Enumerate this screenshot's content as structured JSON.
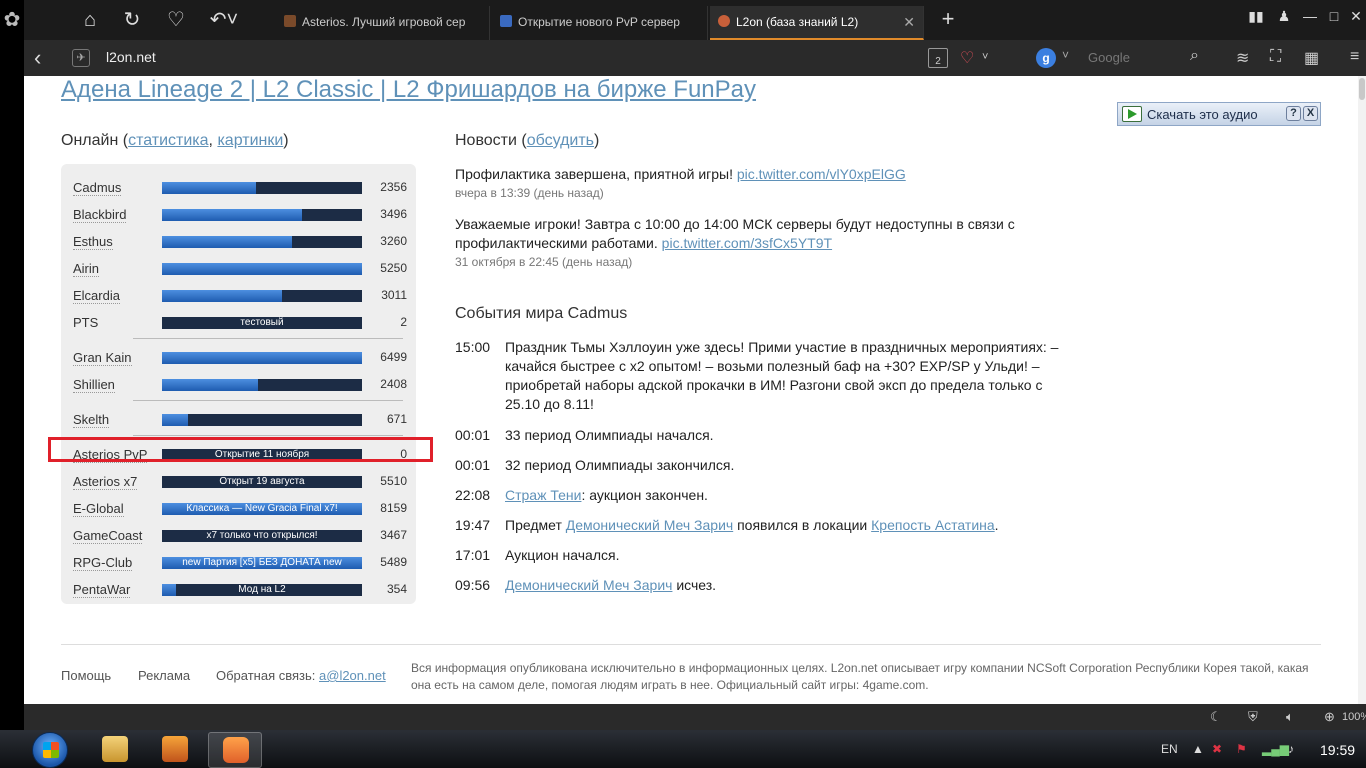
{
  "tabs": [
    {
      "label": "Asterios. Лучший игровой сер"
    },
    {
      "label": "Открытие нового PvP сервер"
    },
    {
      "label": "L2on (база знаний L2)"
    }
  ],
  "address": {
    "url": "l2on.net",
    "search_placeholder": "Google",
    "tab_count": "2"
  },
  "page": {
    "headline": "Адена Lineage 2 | L2 Classic | L2 Фришардов на бирже FunPay",
    "audio_button": "Скачать это аудио",
    "audio_help": "?",
    "audio_close": "X",
    "online": {
      "title": "Онлайн (",
      "link1": "статистика",
      "comma": ", ",
      "link2": "картинки",
      "close": ")"
    },
    "servers": [
      {
        "name": "Cadmus",
        "count": "2356",
        "fill": 0.47,
        "text": ""
      },
      {
        "name": "Blackbird",
        "count": "3496",
        "fill": 0.7,
        "text": ""
      },
      {
        "name": "Esthus",
        "count": "3260",
        "fill": 0.65,
        "text": ""
      },
      {
        "name": "Airin",
        "count": "5250",
        "fill": 1.0,
        "text": ""
      },
      {
        "name": "Elcardia",
        "count": "3011",
        "fill": 0.6,
        "text": ""
      },
      {
        "name": "PTS",
        "count": "2",
        "fill": 0,
        "text": "тестовый"
      },
      {
        "name": "Gran Kain",
        "count": "6499",
        "fill": 1.0,
        "text": ""
      },
      {
        "name": "Shillien",
        "count": "2408",
        "fill": 0.48,
        "text": ""
      },
      {
        "name": "Skelth",
        "count": "671",
        "fill": 0.13,
        "text": ""
      },
      {
        "name": "Asterios PvP",
        "count": "0",
        "fill": 0,
        "text": "Открытие 11 ноября"
      },
      {
        "name": "Asterios x7",
        "count": "5510",
        "fill": 0,
        "text": "Открыт 19 августа"
      },
      {
        "name": "E-Global",
        "count": "8159",
        "fill": 1.0,
        "text": "Классика — New Gracia Final x7!"
      },
      {
        "name": "GameCoast",
        "count": "3467",
        "fill": 0,
        "text": "x7 только что открылся!"
      },
      {
        "name": "RPG-Club",
        "count": "5489",
        "fill": 1.0,
        "text": "new Партия [x5] БЕЗ ДОНАТА new"
      },
      {
        "name": "PentaWar",
        "count": "354",
        "fill": 0.07,
        "text": "Мод на L2"
      }
    ],
    "news": {
      "title": "Новости (",
      "link": "обсудить",
      "close": ")",
      "items": [
        {
          "text": "Профилактика завершена, приятной игры! ",
          "link": "pic.twitter.com/vlY0xpElGG",
          "when": "вчера в 13:39 (день назад)"
        },
        {
          "text": "Уважаемые игроки! Завтра с 10:00 до 14:00 МСК серверы будут недоступны в связи с профилактическими работами. ",
          "link": "pic.twitter.com/3sfCx5YT9T",
          "when": "31 октября в 22:45 (день назад)"
        }
      ]
    },
    "events": {
      "title": "События мира Cadmus",
      "items": [
        {
          "time": "15:00",
          "pre": "Праздник Тьмы Хэллоуин уже здесь! Прими участие в праздничных мероприятиях: – качайся быстрее с x2 опытом! – возьми полезный баф на +30? EXP/SP у Ульди! – приобретай наборы адской прокачки в ИМ! Разгони свой эксп до предела только с 25.10 до 8.11!",
          "link": "",
          "mid": "",
          "link2": "",
          "post": ""
        },
        {
          "time": "00:01",
          "pre": "33 период Олимпиады начался.",
          "link": "",
          "mid": "",
          "link2": "",
          "post": ""
        },
        {
          "time": "00:01",
          "pre": "32 период Олимпиады закончился.",
          "link": "",
          "mid": "",
          "link2": "",
          "post": ""
        },
        {
          "time": "22:08",
          "pre": "",
          "link": "Страж Тени",
          "mid": ": аукцион закончен.",
          "link2": "",
          "post": ""
        },
        {
          "time": "19:47",
          "pre": "Предмет ",
          "link": "Демонический Меч Зарич",
          "mid": " появился в локации ",
          "link2": "Крепость Астатина",
          "post": "."
        },
        {
          "time": "17:01",
          "pre": "Аукцион начался.",
          "link": "",
          "mid": "",
          "link2": "",
          "post": ""
        },
        {
          "time": "09:56",
          "pre": "",
          "link": "Демонический Меч Зарич",
          "mid": " исчез.",
          "link2": "",
          "post": ""
        }
      ]
    },
    "footer": {
      "help": "Помощь",
      "ads": "Реклама",
      "feedback": "Обратная связь: ",
      "email": "a@l2on.net",
      "info": "Вся информация опубликована исключительно в информационных целях. L2on.net описывает игру компании NCSoft Corporation Республики Корея такой, какая она есть на самом деле, помогая людям играть в нее. Официальный сайт игры: 4game.com."
    }
  },
  "statusbar": {
    "zoom": "100%"
  },
  "taskbar": {
    "lang": "EN",
    "time": "19:59"
  },
  "colors": {
    "link": "#5f91b8",
    "bar_fill": "#2a6fcf",
    "bar_bg": "#1c2c45",
    "highlight": "#e0202a",
    "tab_accent": "#e08a2a"
  }
}
